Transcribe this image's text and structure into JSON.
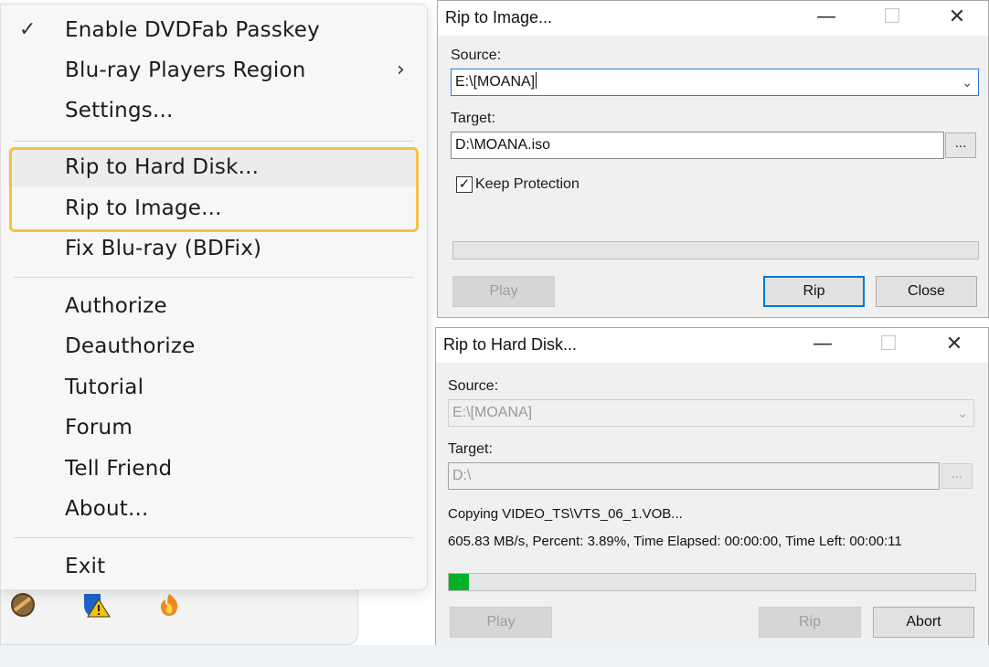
{
  "menu": {
    "items": [
      {
        "label": "Enable DVDFab Passkey",
        "checked": true
      },
      {
        "label": "Blu-ray Players Region",
        "submenu": true
      },
      {
        "label": "Settings..."
      },
      {
        "label": "Rip to Hard Disk...",
        "highlighted": true
      },
      {
        "label": "Rip to Image...",
        "highlighted": true
      },
      {
        "label": "Fix Blu-ray (BDFix)"
      },
      {
        "label": "Authorize"
      },
      {
        "label": "Deauthorize"
      },
      {
        "label": "Tutorial"
      },
      {
        "label": "Forum"
      },
      {
        "label": "Tell Friend"
      },
      {
        "label": "About..."
      },
      {
        "label": "Exit"
      }
    ],
    "check_glyph": "✓",
    "submenu_glyph": "›",
    "highlight_color": "#f5c243"
  },
  "tray": {
    "icons": [
      "dvdfab-passkey-icon",
      "shield-warning-icon",
      "dvdfab-flame-icon"
    ]
  },
  "rip_image": {
    "title": "Rip to Image...",
    "source_label": "Source:",
    "source_value": "E:\\[MOANA]",
    "target_label": "Target:",
    "target_value": "D:\\MOANA.iso",
    "browse_label": "...",
    "keep_protection_label": "Keep Protection",
    "keep_protection_checked": true,
    "progress": 0,
    "play_label": "Play",
    "rip_label": "Rip",
    "close_label": "Close"
  },
  "rip_disk": {
    "title": "Rip to Hard Disk...",
    "source_label": "Source:",
    "source_value": "E:\\[MOANA]",
    "target_label": "Target:",
    "target_value": "D:\\",
    "browse_label": "...",
    "status_line1": "Copying VIDEO_TS\\VTS_06_1.VOB...",
    "status_line2": "605.83 MB/s, Percent: 3.89%, Time Elapsed: 00:00:00, Time Left: 00:00:11",
    "progress_percent": 3.89,
    "progress_color": "#06b025",
    "play_label": "Play",
    "rip_label": "Rip",
    "abort_label": "Abort"
  },
  "window_controls": {
    "minimize": "—",
    "maximize": "☐",
    "close": "✕"
  }
}
